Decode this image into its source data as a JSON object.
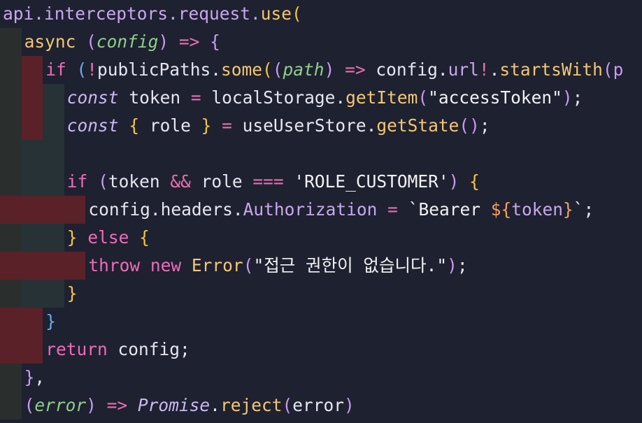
{
  "code": {
    "lines": [
      {
        "tokens": [
          {
            "t": "api.interceptors.request.",
            "c": "prop"
          },
          {
            "t": "use",
            "c": "fn"
          },
          {
            "t": "(",
            "c": "yellow"
          }
        ]
      },
      {
        "tokens": [
          {
            "t": "async ",
            "c": "fn"
          },
          {
            "t": "(",
            "c": "violet"
          },
          {
            "t": "config",
            "c": "param"
          },
          {
            "t": ")",
            "c": "violet"
          },
          {
            "t": " => ",
            "c": "op"
          },
          {
            "t": "{",
            "c": "violet"
          }
        ]
      },
      {
        "tokens": [
          {
            "t": "if ",
            "c": "kw"
          },
          {
            "t": "(",
            "c": "blue"
          },
          {
            "t": "!",
            "c": "op"
          },
          {
            "t": "publicPaths.",
            "c": "plain"
          },
          {
            "t": "some",
            "c": "fn"
          },
          {
            "t": "(",
            "c": "yellow"
          },
          {
            "t": "(",
            "c": "violet"
          },
          {
            "t": "path",
            "c": "param"
          },
          {
            "t": ")",
            "c": "violet"
          },
          {
            "t": " => ",
            "c": "op"
          },
          {
            "t": "config.",
            "c": "plain"
          },
          {
            "t": "url",
            "c": "prop"
          },
          {
            "t": "!",
            "c": "op"
          },
          {
            "t": ".",
            "c": "plain"
          },
          {
            "t": "startsWith",
            "c": "fn"
          },
          {
            "t": "(p",
            "c": "violet"
          }
        ]
      },
      {
        "tokens": [
          {
            "t": "const ",
            "c": "ital"
          },
          {
            "t": "token ",
            "c": "plain"
          },
          {
            "t": "= ",
            "c": "op"
          },
          {
            "t": "localStorage.",
            "c": "plain"
          },
          {
            "t": "getItem",
            "c": "fn"
          },
          {
            "t": "(",
            "c": "violet"
          },
          {
            "t": "\"accessToken\"",
            "c": "str"
          },
          {
            "t": ")",
            "c": "violet"
          },
          {
            "t": ";",
            "c": "plain"
          }
        ]
      },
      {
        "tokens": [
          {
            "t": "const ",
            "c": "ital"
          },
          {
            "t": "{ ",
            "c": "yellow"
          },
          {
            "t": "role ",
            "c": "plain"
          },
          {
            "t": "} ",
            "c": "yellow"
          },
          {
            "t": "= ",
            "c": "op"
          },
          {
            "t": "useUserStore.",
            "c": "plain"
          },
          {
            "t": "getState",
            "c": "fn"
          },
          {
            "t": "()",
            "c": "violet"
          },
          {
            "t": ";",
            "c": "plain"
          }
        ]
      },
      {
        "tokens": []
      },
      {
        "tokens": [
          {
            "t": "if ",
            "c": "kw"
          },
          {
            "t": "(",
            "c": "violet"
          },
          {
            "t": "token ",
            "c": "plain"
          },
          {
            "t": "&& ",
            "c": "op"
          },
          {
            "t": "role ",
            "c": "plain"
          },
          {
            "t": "=== ",
            "c": "op"
          },
          {
            "t": "'ROLE_CUSTOMER'",
            "c": "str"
          },
          {
            "t": ") ",
            "c": "violet"
          },
          {
            "t": "{",
            "c": "yellow"
          }
        ]
      },
      {
        "tokens": [
          {
            "t": "config.headers.",
            "c": "plain"
          },
          {
            "t": "Authorization ",
            "c": "prop"
          },
          {
            "t": "= ",
            "c": "op"
          },
          {
            "t": "`Bearer ",
            "c": "str"
          },
          {
            "t": "${",
            "c": "tplv"
          },
          {
            "t": "token",
            "c": "prop"
          },
          {
            "t": "}",
            "c": "tplv"
          },
          {
            "t": "`",
            "c": "str"
          },
          {
            "t": ";",
            "c": "plain"
          }
        ]
      },
      {
        "tokens": [
          {
            "t": "} ",
            "c": "yellow"
          },
          {
            "t": "else ",
            "c": "kw"
          },
          {
            "t": "{",
            "c": "yellow"
          }
        ]
      },
      {
        "tokens": [
          {
            "t": "throw ",
            "c": "kw"
          },
          {
            "t": "new ",
            "c": "kw"
          },
          {
            "t": "Error",
            "c": "fn"
          },
          {
            "t": "(",
            "c": "violet"
          },
          {
            "t": "\"접근 권한이 없습니다.\"",
            "c": "str"
          },
          {
            "t": ")",
            "c": "violet"
          },
          {
            "t": ";",
            "c": "plain"
          }
        ]
      },
      {
        "tokens": [
          {
            "t": "}",
            "c": "yellow"
          }
        ]
      },
      {
        "tokens": [
          {
            "t": "}",
            "c": "blue"
          }
        ]
      },
      {
        "tokens": [
          {
            "t": "return ",
            "c": "kw"
          },
          {
            "t": "config",
            "c": "plain"
          },
          {
            "t": ";",
            "c": "plain"
          }
        ]
      },
      {
        "tokens": [
          {
            "t": "}",
            "c": "violet"
          },
          {
            "t": ",",
            "c": "plain"
          }
        ]
      },
      {
        "tokens": [
          {
            "t": "(",
            "c": "violet"
          },
          {
            "t": "error",
            "c": "param"
          },
          {
            "t": ")",
            "c": "violet"
          },
          {
            "t": " => ",
            "c": "op"
          },
          {
            "t": "Promise",
            "c": "ital"
          },
          {
            "t": ".",
            "c": "plain"
          },
          {
            "t": "reject",
            "c": "fn"
          },
          {
            "t": "(",
            "c": "violet"
          },
          {
            "t": "error",
            "c": "plain"
          },
          {
            "t": ")",
            "c": "violet"
          }
        ]
      }
    ]
  },
  "colors": {
    "background": "#1e2130",
    "indent_guide_1": "#2a2f2e",
    "indent_guide_2": "#263236",
    "indent_error_highlight": "#5a2128"
  }
}
